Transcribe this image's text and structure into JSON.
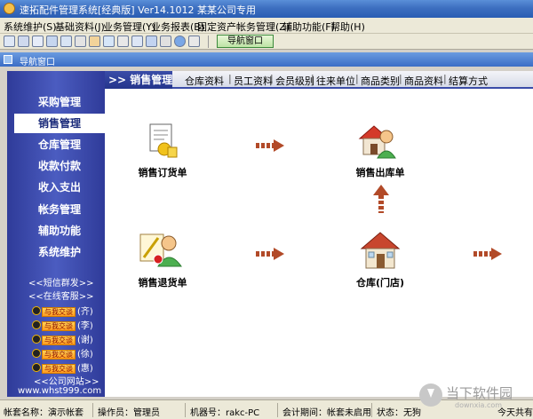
{
  "window": {
    "title": "速拓配件管理系统[经典版] Ver14.1012   某某公司专用"
  },
  "menu": {
    "items": [
      "系统维护(S)",
      "基础资料(J)",
      "业务管理(Y)",
      "业务报表(B)",
      "固定资产",
      "帐务管理(Z)",
      "辅助功能(F)",
      "帮助(H)"
    ]
  },
  "toolbar": {
    "nav_window_label": "导航窗口"
  },
  "child_window": {
    "title": "导航窗口"
  },
  "sidebar": {
    "items": [
      "采购管理",
      "销售管理",
      "仓库管理",
      "收款付款",
      "收入支出",
      "帐务管理",
      "辅助功能",
      "系统维护"
    ],
    "sms_link": "<<短信群发>>",
    "online_service": "<<在线客服>>",
    "qq_badge": "与我交谈",
    "qq_contacts": [
      "(齐)",
      "(李)",
      "(谢)",
      "(徐)",
      "(惠)"
    ],
    "company_site": "<<公司网站>>",
    "website": "www.whst999.com"
  },
  "section_tab": {
    "label": ">> 销售管理"
  },
  "module_links": [
    "仓库资料",
    "员工资料",
    "会员级别",
    "往来单位",
    "商品类别",
    "商品资料",
    "结算方式"
  ],
  "flow": {
    "sales_order": "销售订货单",
    "sales_outbound": "销售出库单",
    "sales_return": "销售退货单",
    "warehouse": "仓库(门店)"
  },
  "statusbar": {
    "account_label": "帐套名称：",
    "account_value": "演示帐套",
    "operator_label": "操作员：",
    "operator_value": "管理员",
    "machine_label": "机器号：",
    "machine_value": "rakc-PC",
    "period_label": "会计期间：",
    "period_value": "帐套未启用",
    "state_label": "状态：",
    "state_value": "无狗",
    "extra": "今天共有"
  },
  "watermark": {
    "text": "当下软件园",
    "sub": "downxia.com"
  },
  "colors": {
    "sidebar_bg": "#3a4ab0",
    "arrow": "#b24a28",
    "title_bar": "#3d6fc0"
  }
}
